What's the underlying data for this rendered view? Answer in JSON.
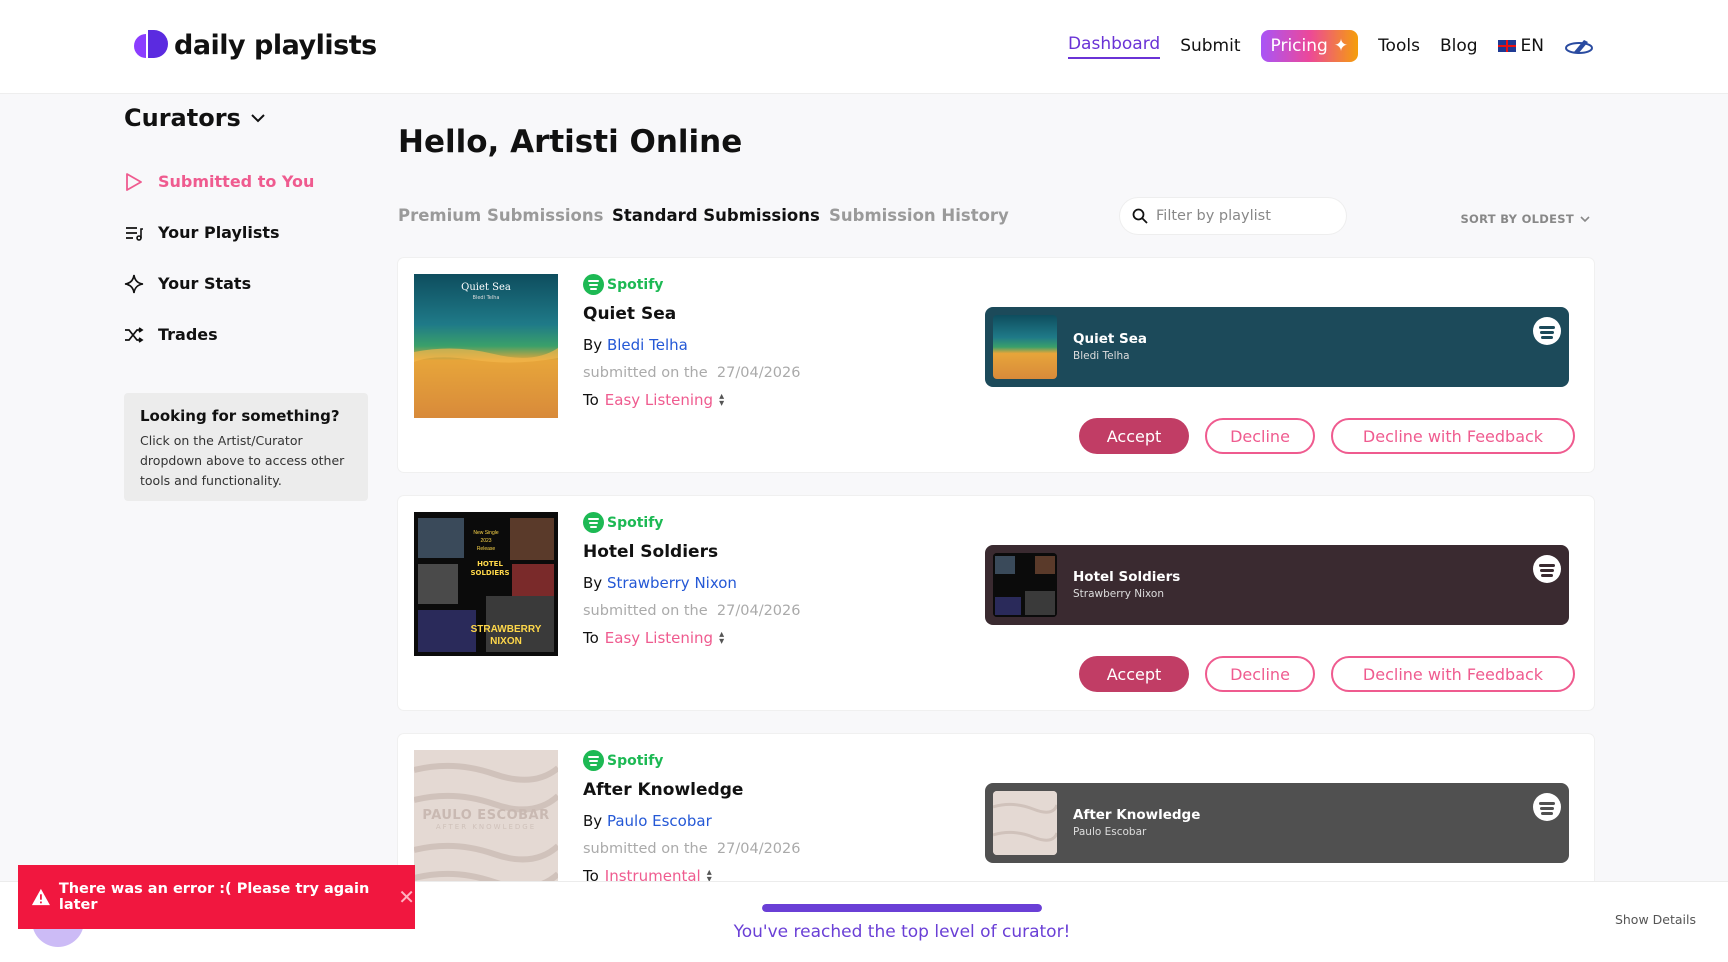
{
  "header": {
    "logo_text": "daily playlists",
    "nav": {
      "dashboard": "Dashboard",
      "submit": "Submit",
      "pricing": "Pricing",
      "tools": "Tools",
      "blog": "Blog",
      "lang": "EN"
    }
  },
  "sidebar": {
    "title": "Curators",
    "items": [
      {
        "label": "Submitted to You",
        "icon": "play-icon"
      },
      {
        "label": "Your Playlists",
        "icon": "playlist-icon"
      },
      {
        "label": "Your Stats",
        "icon": "sparkle-icon"
      },
      {
        "label": "Trades",
        "icon": "shuffle-icon"
      }
    ],
    "help": {
      "title": "Looking for something?",
      "text": "Click on the Artist/Curator dropdown above to access other tools and functionality."
    }
  },
  "main": {
    "greeting": "Hello, Artisti Online",
    "tabs": [
      {
        "label": "Premium Submissions"
      },
      {
        "label": "Standard Submissions"
      },
      {
        "label": "Submission History"
      }
    ],
    "filter_placeholder": "Filter by playlist",
    "sort_label": "SORT BY OLDEST"
  },
  "submissions": [
    {
      "platform": "Spotify",
      "title": "Quiet Sea",
      "by_prefix": "By",
      "artist": "Bledi Telha",
      "submitted_prefix": "submitted on the",
      "date": "27/04/2026",
      "to_prefix": "To",
      "playlist": "Easy Listening",
      "cover_text": "Quiet Sea",
      "cover_sub": "Bledi Telha",
      "embed_bg": "#1c4a5a"
    },
    {
      "platform": "Spotify",
      "title": "Hotel Soldiers",
      "by_prefix": "By",
      "artist": "Strawberry Nixon",
      "submitted_prefix": "submitted on the",
      "date": "27/04/2026",
      "to_prefix": "To",
      "playlist": "Easy Listening",
      "cover_text": "HOTEL SOLDIERS",
      "cover_sub": "STRAWBERRY NIXON",
      "embed_bg": "#3a2a30"
    },
    {
      "platform": "Spotify",
      "title": "After Knowledge",
      "by_prefix": "By",
      "artist": "Paulo Escobar",
      "submitted_prefix": "submitted on the",
      "date": "27/04/2026",
      "to_prefix": "To",
      "playlist": "Instrumental",
      "cover_text": "PAULO ESCOBAR",
      "cover_sub": "AFTER KNOWLEDGE",
      "embed_bg": "#505050"
    }
  ],
  "actions": {
    "accept": "Accept",
    "decline": "Decline",
    "feedback": "Decline with Feedback"
  },
  "bottom": {
    "level_text": "You've reached the top level of curator!",
    "show_details": "Show Details",
    "progress": 1.0
  },
  "toast": {
    "message": "There was an error :( Please try again later"
  },
  "colors": {
    "accent": "#6a33d6",
    "pink": "#ef5b8f",
    "accept": "#c13d65",
    "spotify": "#1db954",
    "error": "#f1173f"
  }
}
